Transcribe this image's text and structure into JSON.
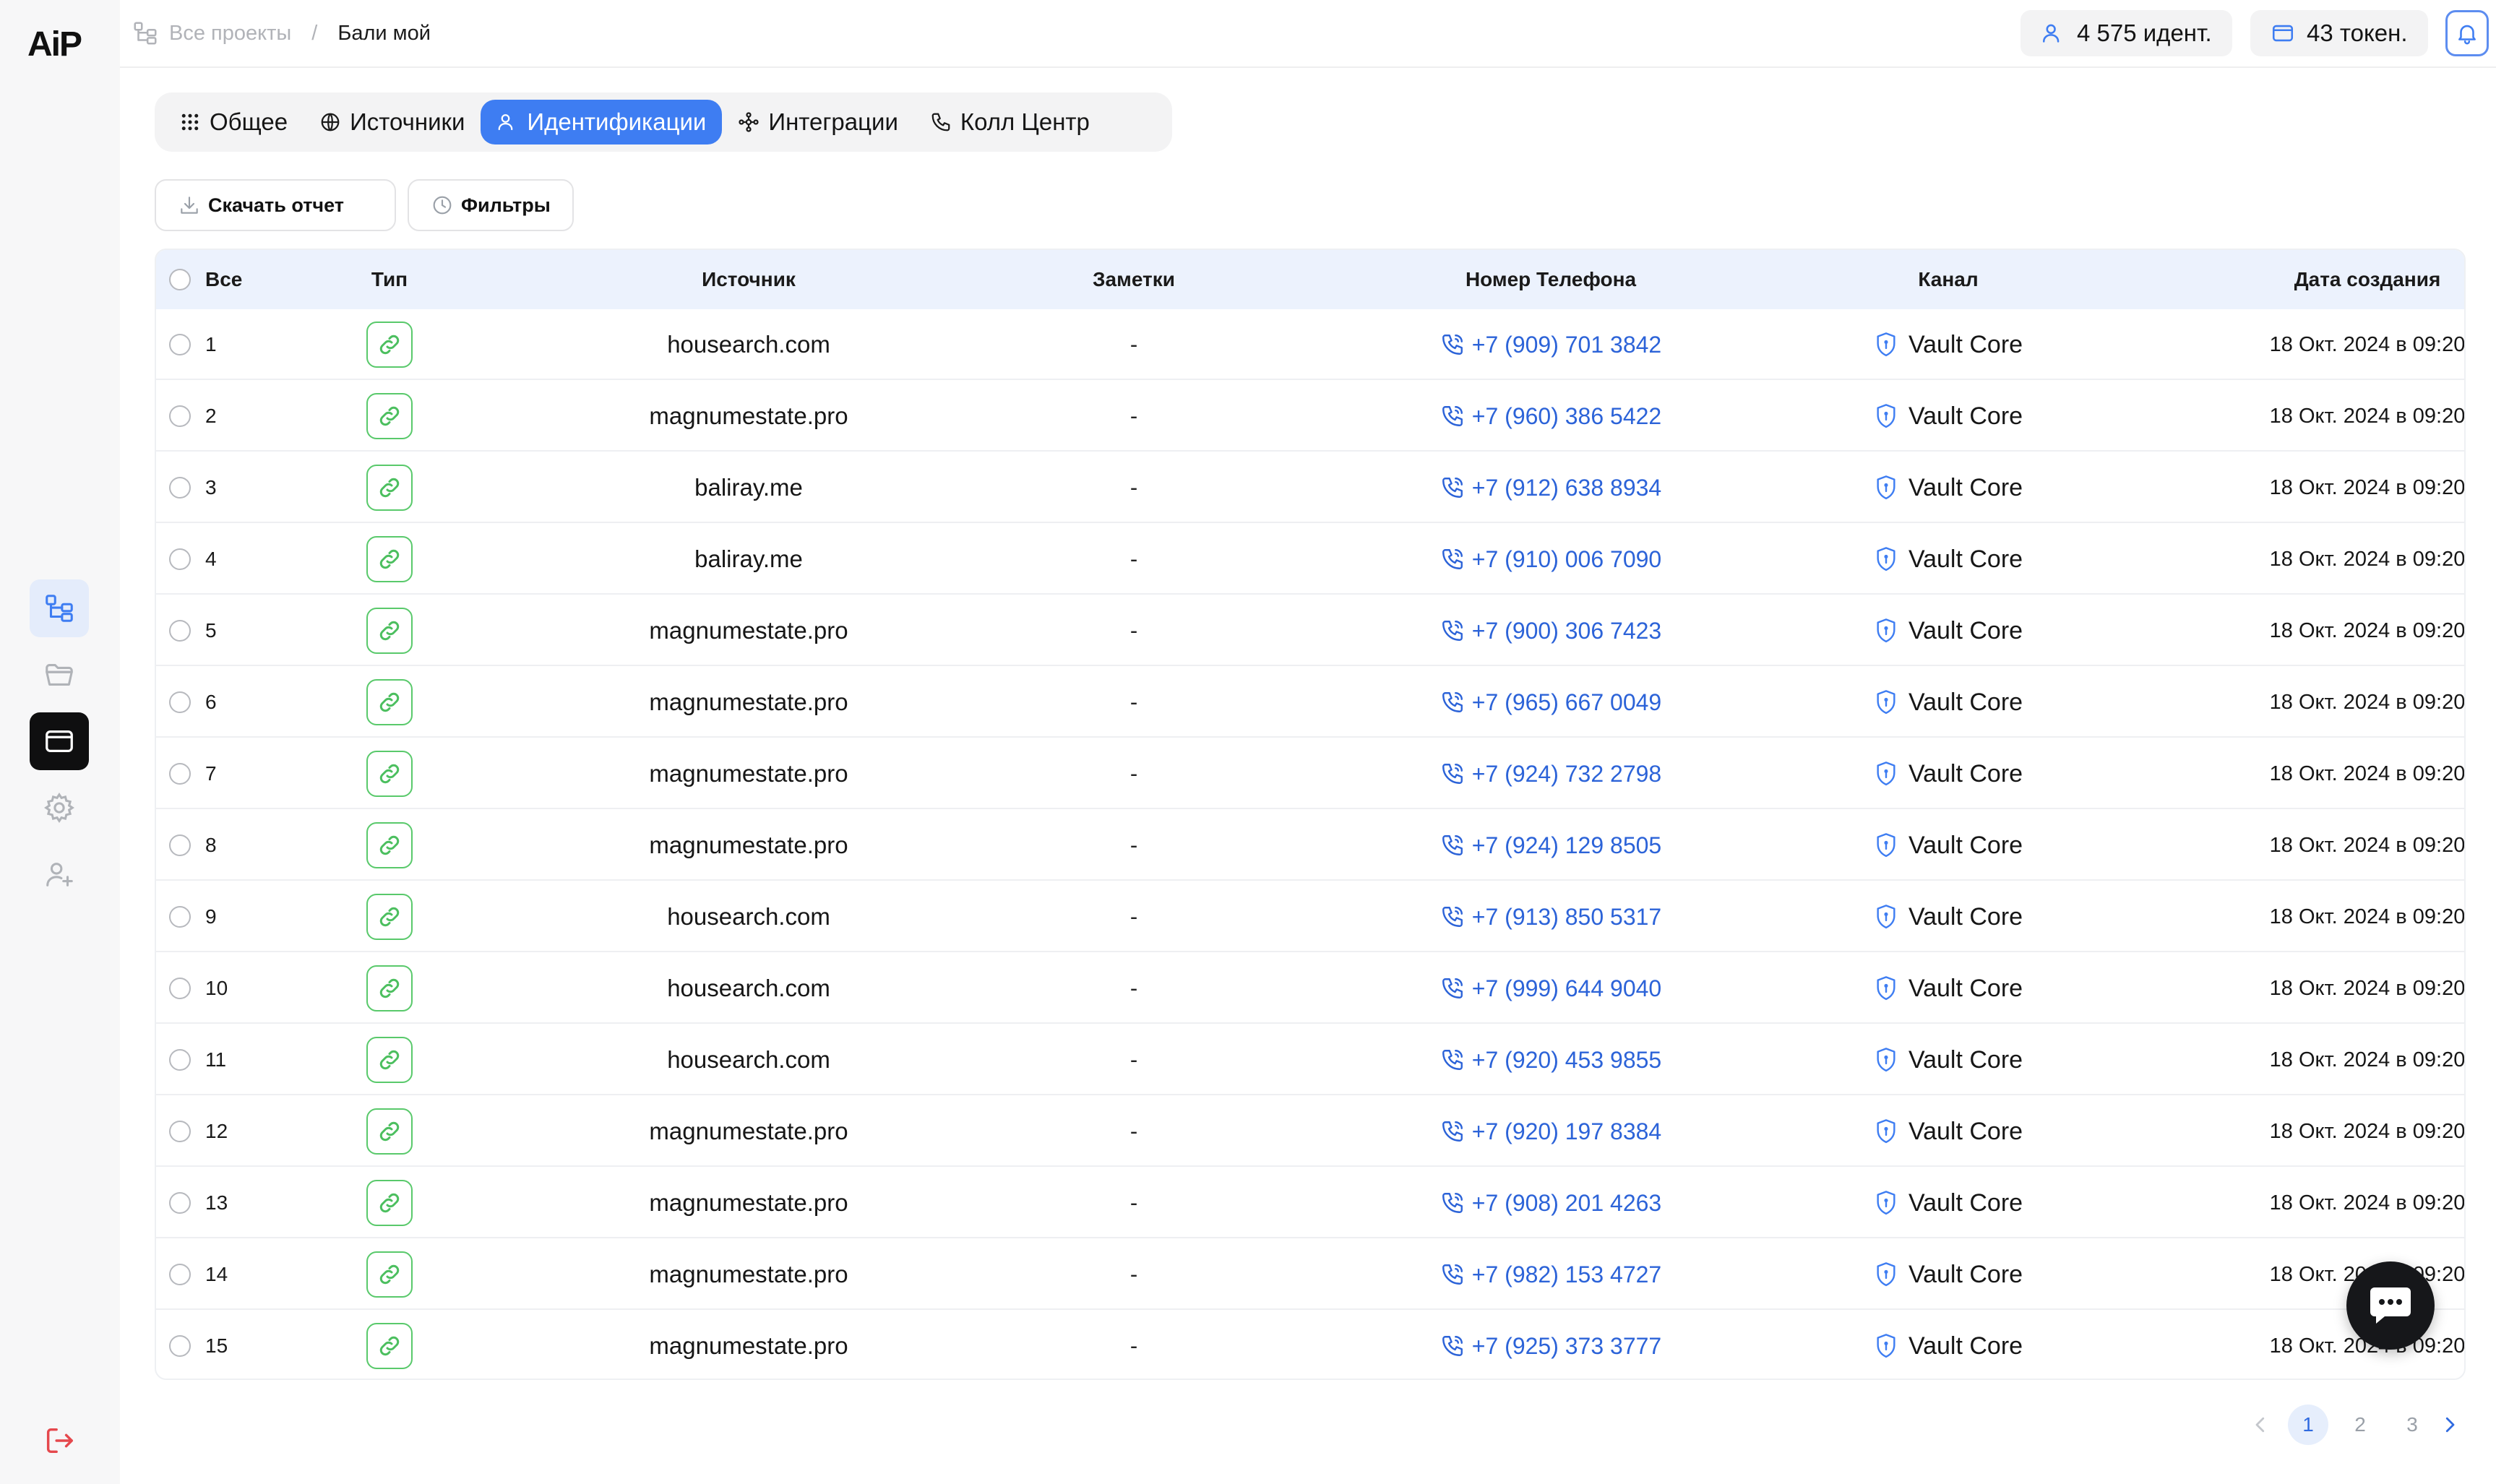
{
  "logo": "AiP",
  "breadcrumb": {
    "root": "Все проекты",
    "separator": "/",
    "current": "Бали мой"
  },
  "header": {
    "identifications": "4 575 идент.",
    "tokens": "43 токен."
  },
  "sidebar": {
    "items": [
      {
        "icon": "projects-icon",
        "active": true
      },
      {
        "icon": "folder-icon",
        "active": false
      },
      {
        "icon": "wallet-icon",
        "active": false
      },
      {
        "icon": "gear-icon",
        "active": false
      },
      {
        "icon": "add-user-icon",
        "active": false
      },
      {
        "icon": "logout-icon",
        "active": false
      }
    ]
  },
  "tabs": [
    {
      "label": "Общее",
      "icon": "grid-icon",
      "active": false
    },
    {
      "label": "Источники",
      "icon": "globe-icon",
      "active": false
    },
    {
      "label": "Идентификации",
      "icon": "user-icon",
      "active": true
    },
    {
      "label": "Интеграции",
      "icon": "integration-icon",
      "active": false
    },
    {
      "label": "Колл Центр",
      "icon": "phone-icon",
      "active": false
    }
  ],
  "toolbar": {
    "download_label": "Скачать отчет",
    "filters_label": "Фильтры"
  },
  "table": {
    "columns": {
      "all": "Все",
      "type": "Тип",
      "source": "Источник",
      "notes": "Заметки",
      "phone": "Номер Телефона",
      "channel": "Канал",
      "created": "Дата создания"
    },
    "rows": [
      {
        "num": "1",
        "source": "housearch.com",
        "notes": "-",
        "phone": "+7 (909) 701 3842",
        "channel": "Vault Core",
        "created": "18 Окт. 2024 в 09:20"
      },
      {
        "num": "2",
        "source": "magnumestate.pro",
        "notes": "-",
        "phone": "+7 (960) 386 5422",
        "channel": "Vault Core",
        "created": "18 Окт. 2024 в 09:20"
      },
      {
        "num": "3",
        "source": "baliray.me",
        "notes": "-",
        "phone": "+7 (912) 638 8934",
        "channel": "Vault Core",
        "created": "18 Окт. 2024 в 09:20"
      },
      {
        "num": "4",
        "source": "baliray.me",
        "notes": "-",
        "phone": "+7 (910) 006 7090",
        "channel": "Vault Core",
        "created": "18 Окт. 2024 в 09:20"
      },
      {
        "num": "5",
        "source": "magnumestate.pro",
        "notes": "-",
        "phone": "+7 (900) 306 7423",
        "channel": "Vault Core",
        "created": "18 Окт. 2024 в 09:20"
      },
      {
        "num": "6",
        "source": "magnumestate.pro",
        "notes": "-",
        "phone": "+7 (965) 667 0049",
        "channel": "Vault Core",
        "created": "18 Окт. 2024 в 09:20"
      },
      {
        "num": "7",
        "source": "magnumestate.pro",
        "notes": "-",
        "phone": "+7 (924) 732 2798",
        "channel": "Vault Core",
        "created": "18 Окт. 2024 в 09:20"
      },
      {
        "num": "8",
        "source": "magnumestate.pro",
        "notes": "-",
        "phone": "+7 (924) 129 8505",
        "channel": "Vault Core",
        "created": "18 Окт. 2024 в 09:20"
      },
      {
        "num": "9",
        "source": "housearch.com",
        "notes": "-",
        "phone": "+7 (913) 850 5317",
        "channel": "Vault Core",
        "created": "18 Окт. 2024 в 09:20"
      },
      {
        "num": "10",
        "source": "housearch.com",
        "notes": "-",
        "phone": "+7 (999) 644 9040",
        "channel": "Vault Core",
        "created": "18 Окт. 2024 в 09:20"
      },
      {
        "num": "11",
        "source": "housearch.com",
        "notes": "-",
        "phone": "+7 (920) 453 9855",
        "channel": "Vault Core",
        "created": "18 Окт. 2024 в 09:20"
      },
      {
        "num": "12",
        "source": "magnumestate.pro",
        "notes": "-",
        "phone": "+7 (920) 197 8384",
        "channel": "Vault Core",
        "created": "18 Окт. 2024 в 09:20"
      },
      {
        "num": "13",
        "source": "magnumestate.pro",
        "notes": "-",
        "phone": "+7 (908) 201 4263",
        "channel": "Vault Core",
        "created": "18 Окт. 2024 в 09:20"
      },
      {
        "num": "14",
        "source": "magnumestate.pro",
        "notes": "-",
        "phone": "+7 (982) 153 4727",
        "channel": "Vault Core",
        "created": "18 Окт. 2024 в 09:20"
      },
      {
        "num": "15",
        "source": "magnumestate.pro",
        "notes": "-",
        "phone": "+7 (925) 373 3777",
        "channel": "Vault Core",
        "created": "18 Окт. 2024 в 09:20"
      }
    ]
  },
  "pagination": {
    "pages": [
      "1",
      "2",
      "3"
    ],
    "current": "1"
  },
  "colors": {
    "accent": "#3e7df2",
    "link": "#2c63d8",
    "type_green": "#59c96b",
    "header_bg": "#ecf2fd",
    "logout_red": "#e5484d"
  }
}
